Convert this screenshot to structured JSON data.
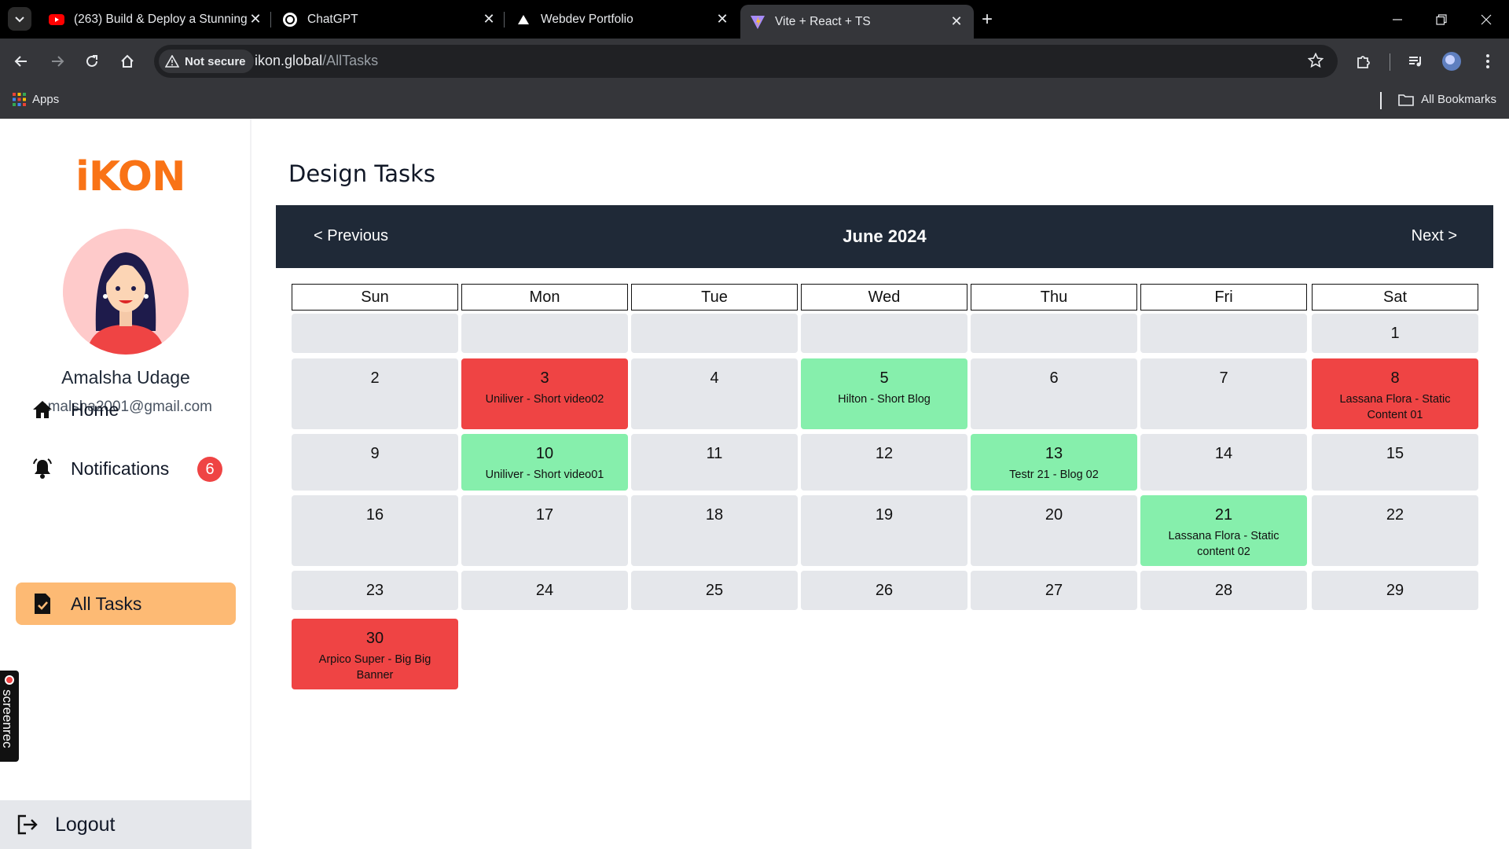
{
  "browser": {
    "tabs": [
      {
        "title": "(263) Build & Deploy a Stunning",
        "icon": "youtube-icon"
      },
      {
        "title": "ChatGPT",
        "icon": "chatgpt-icon"
      },
      {
        "title": "Webdev Portfolio",
        "icon": "triangle-icon"
      },
      {
        "title": "Vite + React + TS",
        "icon": "vite-icon"
      }
    ],
    "security_label": "Not secure",
    "url_host": "ikon.global",
    "url_path": "/AllTasks",
    "bookmarks": {
      "apps": "Apps",
      "all": "All Bookmarks"
    }
  },
  "sidebar": {
    "logo": "iKON",
    "user_name": "Amalsha Udage",
    "user_email": "amalsha2001@gmail.com",
    "nav": [
      {
        "label": "Home",
        "icon": "home-icon"
      },
      {
        "label": "Notifications",
        "icon": "bell-icon",
        "badge": "6"
      },
      {
        "label": "All Tasks",
        "icon": "task-icon",
        "active": true
      }
    ],
    "logout": "Logout"
  },
  "recorder": "screenrec",
  "main": {
    "title": "Design Tasks",
    "prev": "< Previous",
    "month": "June 2024",
    "next": "Next >",
    "weekdays": [
      "Sun",
      "Mon",
      "Tue",
      "Wed",
      "Thu",
      "Fri",
      "Sat"
    ],
    "weeks": [
      [
        null,
        null,
        null,
        null,
        null,
        null,
        {
          "day": "1"
        }
      ],
      [
        {
          "day": "2"
        },
        {
          "day": "3",
          "task": "Uniliver - Short video02",
          "status": "red"
        },
        {
          "day": "4"
        },
        {
          "day": "5",
          "task": "Hilton - Short Blog",
          "status": "green"
        },
        {
          "day": "6"
        },
        {
          "day": "7"
        },
        {
          "day": "8",
          "task": "Lassana Flora - Static Content 01",
          "status": "red"
        }
      ],
      [
        {
          "day": "9"
        },
        {
          "day": "10",
          "task": "Uniliver - Short video01",
          "status": "green"
        },
        {
          "day": "11"
        },
        {
          "day": "12"
        },
        {
          "day": "13",
          "task": "Testr 21 - Blog 02",
          "status": "green"
        },
        {
          "day": "14"
        },
        {
          "day": "15"
        }
      ],
      [
        {
          "day": "16"
        },
        {
          "day": "17"
        },
        {
          "day": "18"
        },
        {
          "day": "19"
        },
        {
          "day": "20"
        },
        {
          "day": "21",
          "task": "Lassana Flora - Static content 02",
          "status": "green"
        },
        {
          "day": "22"
        }
      ],
      [
        {
          "day": "23"
        },
        {
          "day": "24"
        },
        {
          "day": "25"
        },
        {
          "day": "26"
        },
        {
          "day": "27"
        },
        {
          "day": "28"
        },
        {
          "day": "29"
        }
      ],
      [
        {
          "day": "30",
          "task": "Arpico Super - Big Big Banner",
          "status": "red"
        }
      ]
    ]
  }
}
